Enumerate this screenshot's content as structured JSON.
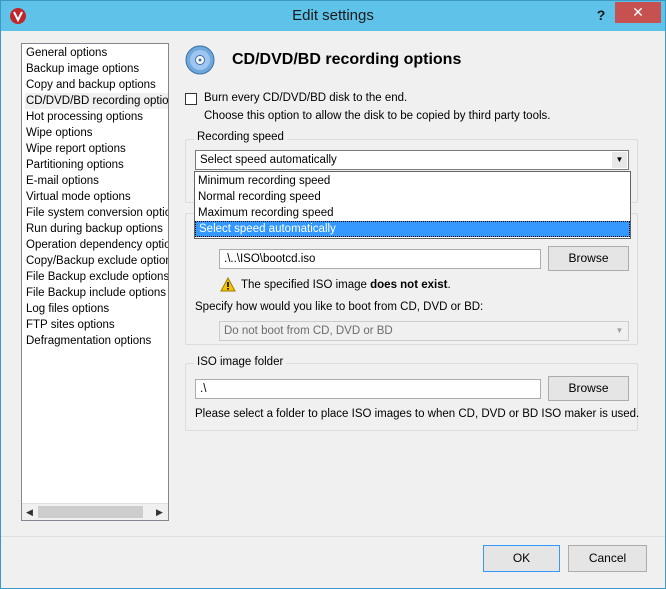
{
  "window": {
    "title": "Edit settings",
    "help_label": "?",
    "close_label": "✕"
  },
  "nav": {
    "items": [
      "General options",
      "Backup image options",
      "Copy and backup options",
      "CD/DVD/BD recording options",
      "Hot processing options",
      "Wipe options",
      "Wipe report options",
      "Partitioning options",
      "E-mail options",
      "Virtual mode options",
      "File system conversion options",
      "Run during backup options",
      "Operation dependency options",
      "Copy/Backup exclude options",
      "File Backup exclude options",
      "File Backup include options",
      "Log files options",
      "FTP sites options",
      "Defragmentation options"
    ],
    "selected": "CD/DVD/BD recording options",
    "scroll_left": "◀",
    "scroll_right": "▶"
  },
  "page": {
    "title": "CD/DVD/BD recording options",
    "burn_checkbox_label": "Burn every CD/DVD/BD disk to the end.",
    "burn_description": "Choose this option to allow the disk to be copied by third party tools.",
    "burn_checked": false
  },
  "recording_speed": {
    "group_title": "Recording speed",
    "selected": "Select speed automatically",
    "options": [
      "Minimum recording speed",
      "Normal recording speed",
      "Maximum recording speed",
      "Select speed automatically"
    ],
    "highlighted_index": 3
  },
  "boot": {
    "iso_path": ".\\..\\ISO\\bootcd.iso",
    "browse_label": "Browse",
    "warning_prefix": "The specified ISO image ",
    "warning_bold": "does not exist",
    "warning_suffix": ".",
    "boot_question": "Specify how would you like to boot from CD, DVD or BD:",
    "boot_selected": "Do not boot from CD, DVD or BD"
  },
  "iso_folder": {
    "group_title": "ISO image folder",
    "path": ".\\",
    "browse_label": "Browse",
    "description": "Please select a folder to place ISO images to when CD, DVD or BD ISO maker is used."
  },
  "footer": {
    "ok_label": "OK",
    "cancel_label": "Cancel"
  },
  "icons": {
    "app": "app-logo-icon",
    "disc": "disc-icon",
    "warning": "warning-icon",
    "dropdown": "chevron-down-icon"
  },
  "colors": {
    "titlebar": "#5fc2e9",
    "close": "#c75050",
    "highlight": "#3399ff"
  }
}
